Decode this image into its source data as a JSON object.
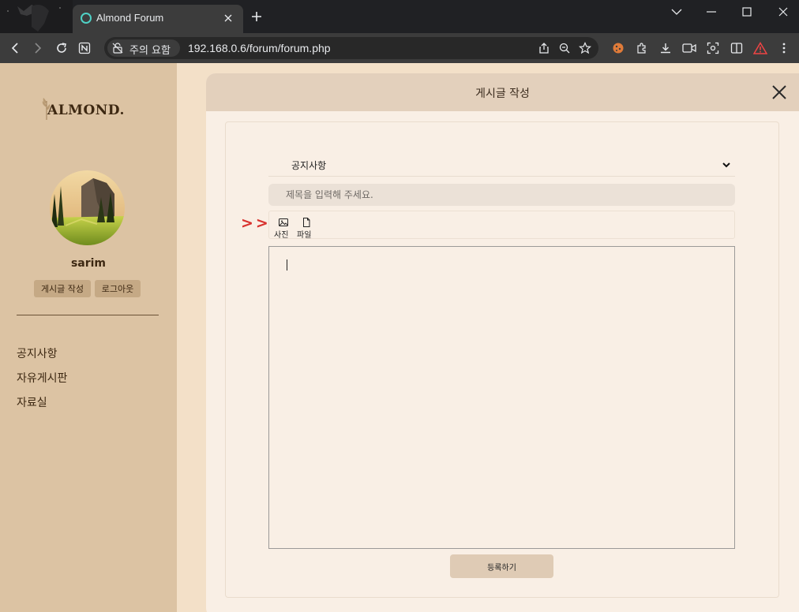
{
  "browser": {
    "tab_title": "Almond Forum",
    "security_chip": "주의 요함",
    "url": "192.168.0.6/forum/forum.php"
  },
  "sidebar": {
    "logo": "ALMOND.",
    "username": "sarim",
    "buttons": [
      {
        "label": "게시글 작성"
      },
      {
        "label": "로그아웃"
      }
    ],
    "menu": [
      {
        "label": "공지사항"
      },
      {
        "label": "자유게시판"
      },
      {
        "label": "자료실"
      }
    ]
  },
  "modal": {
    "title": "게시글 작성",
    "category": "공지사항",
    "title_placeholder": "제목을 입력해 주세요.",
    "marker": ">>",
    "attach": [
      {
        "label": "사진",
        "icon": "image-icon"
      },
      {
        "label": "파일",
        "icon": "file-icon"
      }
    ],
    "submit_label": "등록하기"
  }
}
